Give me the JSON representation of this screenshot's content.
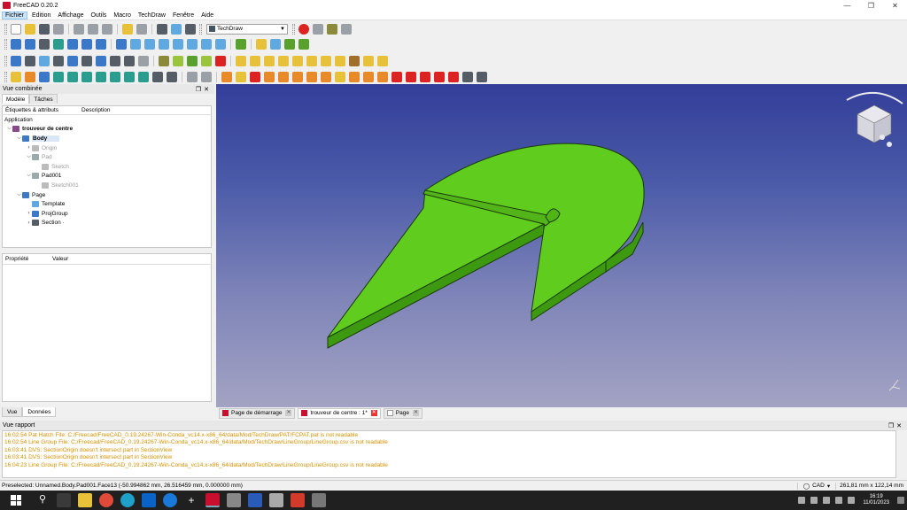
{
  "window": {
    "title": "FreeCAD 0.20.2"
  },
  "menu": [
    "Fichier",
    "Edition",
    "Affichage",
    "Outils",
    "Macro",
    "TechDraw",
    "Fenêtre",
    "Aide"
  ],
  "toolbar": {
    "workbench": "TechDraw"
  },
  "combo": {
    "title": "Vue combinée",
    "tabs": [
      "Modèle",
      "Tâches"
    ],
    "tree_columns": [
      "Étiquettes & attributs",
      "Description"
    ],
    "root_label": "Application",
    "tree": [
      {
        "label": "trouveur de centre",
        "depth": 0,
        "twisty": "v",
        "icon": "document-icon",
        "dim": false
      },
      {
        "label": "Body",
        "depth": 1,
        "twisty": "v",
        "icon": "body-icon",
        "dim": false,
        "bold": true
      },
      {
        "label": "Origin",
        "depth": 2,
        "twisty": ">",
        "icon": "origin-icon",
        "dim": true
      },
      {
        "label": "Pad",
        "depth": 2,
        "twisty": "v",
        "icon": "pad-icon",
        "dim": true
      },
      {
        "label": "Sketch",
        "depth": 3,
        "twisty": "",
        "icon": "sketch-icon",
        "dim": true
      },
      {
        "label": "Pad001",
        "depth": 2,
        "twisty": "v",
        "icon": "pad-icon",
        "dim": false
      },
      {
        "label": "Sketch001",
        "depth": 3,
        "twisty": "",
        "icon": "sketch-icon",
        "dim": true
      },
      {
        "label": "Page",
        "depth": 1,
        "twisty": "v",
        "icon": "page-icon",
        "dim": false
      },
      {
        "label": "Template",
        "depth": 2,
        "twisty": "",
        "icon": "template-icon",
        "dim": false
      },
      {
        "label": "ProjGroup",
        "depth": 2,
        "twisty": ">",
        "icon": "projgroup-icon",
        "dim": false
      },
      {
        "label": "Section ·",
        "depth": 2,
        "twisty": ">",
        "icon": "section-icon",
        "dim": false
      }
    ],
    "prop_columns": [
      "Propriété",
      "Valeur"
    ],
    "bottom_tabs": [
      "Vue",
      "Données"
    ]
  },
  "doc_tabs": [
    {
      "label": "Page de démarrage",
      "active": false,
      "icon": "freecad-icon"
    },
    {
      "label": "trouveur de centre : 1*",
      "active": true,
      "icon": "freecad-icon"
    },
    {
      "label": "Page",
      "active": false,
      "icon": "page-icon"
    }
  ],
  "report": {
    "title": "Vue rapport",
    "lines": [
      "16:02:54  Pat Hatch File: C:/Freecad/FreeCAD_0.19.24267-Win-Conda_vc14.x-x86_64/data/Mod/TechDraw/PAT/FCPAT.pat is not readable",
      "16:02:54  Line Group File: C:/Freecad/FreeCAD_0.19.24267-Win-Conda_vc14.x-x86_64/data/Mod/TechDraw/LineGroup/LineGroup.csv is not readable",
      "16:03:41  DVS: SectionOrigin doesn't intersect part in SectionView",
      "16:03:41  DVS: SectionOrigin doesn't intersect part in SectionView",
      "16:04:23  Line Group File: C:/Freecad/FreeCAD_0.19.24267-Win-Conda_vc14.x-x86_64/data/Mod/TechDraw/LineGroup/LineGroup.csv is not readable"
    ]
  },
  "status": {
    "preselected": "Preselected: Unnamed.Body.Pad001.Face13 (-50.994862 mm, 26.516459 mm, 0.000000 mm)",
    "nav_style": "CAD",
    "dimensions": "261,81 mm x 122,14 mm"
  },
  "taskbar": {
    "time": "16:19",
    "date": "11/01/2023"
  },
  "colors": {
    "part_fill": "#5fcc1e",
    "part_edge": "#1a3a0a",
    "viewport_top": "#333e99",
    "viewport_bottom": "#a3a3c3"
  }
}
